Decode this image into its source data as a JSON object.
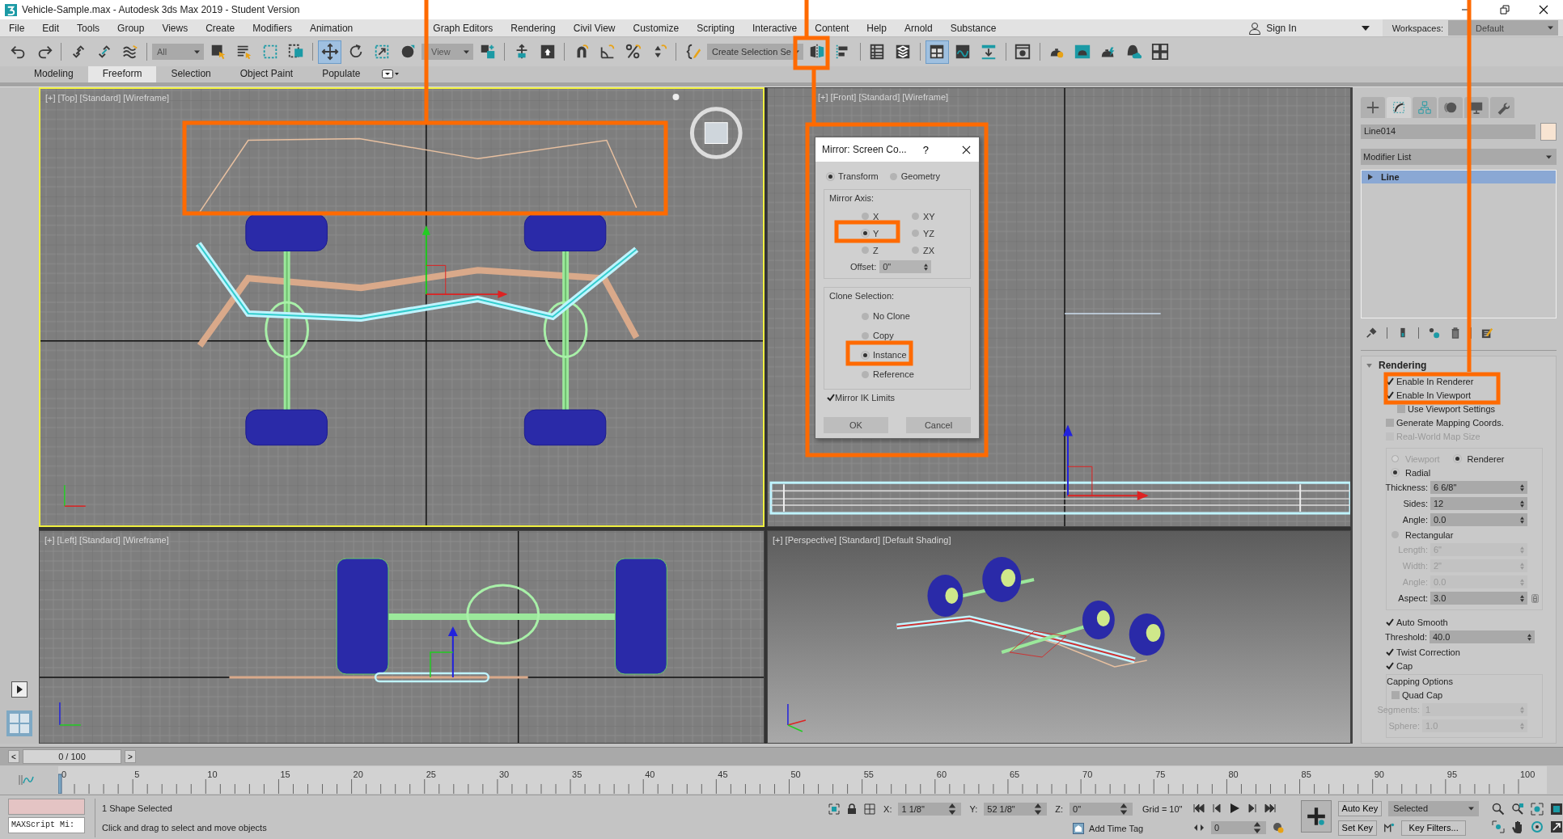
{
  "window": {
    "title": "Vehicle-Sample.max - Autodesk 3ds Max 2019 - Student Version"
  },
  "menu_bar": {
    "items": [
      "File",
      "Edit",
      "Tools",
      "Group",
      "Views",
      "Create",
      "Modifiers",
      "Animation",
      "Graph Editors",
      "Rendering",
      "Civil View",
      "Customize",
      "Scripting",
      "Interactive",
      "Content",
      "Help",
      "Arnold",
      "Substance"
    ],
    "sign_in": "Sign In",
    "workspaces_label": "Workspaces:",
    "workspace": "Default"
  },
  "main_toolbar": [
    {
      "kind": "icon",
      "selected": false
    },
    {
      "kind": "icon",
      "selected": false
    },
    {
      "kind": "separator"
    },
    {
      "kind": "icon",
      "selected": false
    },
    {
      "kind": "icon",
      "selected": false
    },
    {
      "kind": "icon",
      "selected": false
    },
    {
      "kind": "separator"
    },
    {
      "kind": "dropdown",
      "value": "All"
    },
    {
      "kind": "icon",
      "selected": false
    },
    {
      "kind": "icon",
      "selected": false
    },
    {
      "kind": "icon",
      "selected": false
    },
    {
      "kind": "icon",
      "selected": false
    },
    {
      "kind": "separator"
    },
    {
      "kind": "icon",
      "selected": true
    },
    {
      "kind": "icon",
      "selected": false
    },
    {
      "kind": "icon",
      "selected": false
    },
    {
      "kind": "icon",
      "selected": false
    },
    {
      "kind": "dropdown",
      "value": "View"
    },
    {
      "kind": "icon",
      "selected": false
    },
    {
      "kind": "separator"
    },
    {
      "kind": "icon",
      "selected": false
    },
    {
      "kind": "icon",
      "selected": false
    },
    {
      "kind": "separator"
    },
    {
      "kind": "icon",
      "selected": false
    },
    {
      "kind": "icon",
      "selected": false
    },
    {
      "kind": "icon",
      "selected": false
    },
    {
      "kind": "icon",
      "selected": false
    },
    {
      "kind": "separator"
    },
    {
      "kind": "icon",
      "selected": false
    },
    {
      "kind": "dropdown",
      "value": "Create Selection Se"
    },
    {
      "kind": "icon",
      "selected": false
    },
    {
      "kind": "icon",
      "selected": false
    },
    {
      "kind": "separator"
    },
    {
      "kind": "icon",
      "selected": false
    },
    {
      "kind": "icon",
      "selected": false
    },
    {
      "kind": "separator"
    },
    {
      "kind": "icon",
      "selected": true
    },
    {
      "kind": "icon",
      "selected": false
    },
    {
      "kind": "icon",
      "selected": false
    },
    {
      "kind": "separator"
    },
    {
      "kind": "icon",
      "selected": false
    },
    {
      "kind": "separator"
    },
    {
      "kind": "icon",
      "selected": false
    },
    {
      "kind": "icon",
      "selected": false
    },
    {
      "kind": "icon",
      "selected": false
    },
    {
      "kind": "icon",
      "selected": false
    },
    {
      "kind": "icon",
      "selected": false
    }
  ],
  "ribbon_tabs": [
    {
      "label": "Modeling",
      "selected": false
    },
    {
      "label": "Freeform",
      "selected": true
    },
    {
      "label": "Selection",
      "selected": false
    },
    {
      "label": "Object Paint",
      "selected": false
    },
    {
      "label": "Populate",
      "selected": false
    }
  ],
  "viewports": [
    {
      "kind": "top",
      "label": "[+] [Top] [Standard] [Wireframe]",
      "active": true
    },
    {
      "kind": "front",
      "label": "[+] [Front] [Standard] [Wireframe]",
      "active": false
    },
    {
      "kind": "left",
      "label": "[+] [Left] [Standard] [Wireframe]",
      "active": false
    },
    {
      "kind": "perspective",
      "label": "[+] [Perspective] [Standard] [Default Shading]",
      "active": false
    }
  ],
  "mirror_dialog": {
    "title": "Mirror: Screen Co...",
    "help": "?",
    "mode": [
      {
        "label": "Transform",
        "selected": true
      },
      {
        "label": "Geometry",
        "selected": false
      }
    ],
    "mirror_axis": {
      "title": "Mirror Axis:",
      "axes": [
        {
          "label": "X",
          "selected": false
        },
        {
          "label": "Y",
          "selected": true
        },
        {
          "label": "Z",
          "selected": false
        },
        {
          "label": "XY",
          "selected": false
        },
        {
          "label": "YZ",
          "selected": false
        },
        {
          "label": "ZX",
          "selected": false
        }
      ],
      "offset_label": "Offset:",
      "offset": "0\""
    },
    "clone_selection": {
      "title": "Clone Selection:",
      "options": [
        {
          "label": "No Clone",
          "selected": false
        },
        {
          "label": "Copy",
          "selected": false
        },
        {
          "label": "Instance",
          "selected": true
        },
        {
          "label": "Reference",
          "selected": false
        }
      ]
    },
    "mirror_ik_limits": {
      "label": "Mirror IK Limits",
      "checked": true
    },
    "buttons": [
      "OK",
      "Cancel"
    ]
  },
  "command_panel": {
    "tabs": [
      {
        "selected": false
      },
      {
        "selected": true
      },
      {
        "selected": false
      },
      {
        "selected": false
      },
      {
        "selected": false
      },
      {
        "selected": false
      }
    ],
    "object_name": "Line014",
    "modifier_list": "Modifier List",
    "stack": [
      {
        "label": "Line",
        "selected": true
      }
    ],
    "rendering": {
      "title": "Rendering",
      "expanded": true,
      "checks": [
        {
          "label": "Enable In Renderer",
          "checked": true,
          "disabled": false
        },
        {
          "label": "Enable In Viewport",
          "checked": true,
          "disabled": false,
          "children": [
            {
              "label": "Use Viewport Settings",
              "checked": false,
              "disabled": false
            }
          ]
        },
        {
          "label": "Generate Mapping Coords.",
          "checked": false,
          "disabled": false
        },
        {
          "label": "Real-World Map Size",
          "checked": false,
          "disabled": true
        }
      ],
      "mode": [
        {
          "label": "Viewport",
          "selected": false,
          "disabled": true
        },
        {
          "label": "Renderer",
          "selected": true,
          "disabled": false
        }
      ],
      "shapes": [
        {
          "label": "Radial",
          "selected": true,
          "params": [
            {
              "label": "Thickness:",
              "value": "6 6/8\"",
              "disabled": false
            },
            {
              "label": "Sides:",
              "value": "12",
              "disabled": false
            },
            {
              "label": "Angle:",
              "value": "0.0",
              "disabled": false
            }
          ]
        },
        {
          "label": "Rectangular",
          "selected": false,
          "params": [
            {
              "label": "Length:",
              "value": "6\"",
              "disabled": true
            },
            {
              "label": "Width:",
              "value": "2\"",
              "disabled": true
            },
            {
              "label": "Angle:",
              "value": "0.0",
              "disabled": true
            },
            {
              "label": "Aspect:",
              "value": "3.0",
              "disabled": false
            }
          ]
        }
      ],
      "auto_smooth": {
        "label": "Auto Smooth",
        "checked": true,
        "threshold": {
          "label": "Threshold:",
          "value": "40.0",
          "disabled": false
        }
      },
      "twist_correction": {
        "label": "Twist Correction",
        "checked": true
      },
      "cap": {
        "label": "Cap",
        "checked": true
      },
      "capping": {
        "title": "Capping Options",
        "quad_cap": {
          "label": "Quad Cap",
          "checked": false
        },
        "params": [
          {
            "label": "Segments:",
            "value": "1",
            "disabled": true
          },
          {
            "label": "Sphere:",
            "value": "1.0",
            "disabled": true
          }
        ]
      }
    }
  },
  "time_slider": {
    "prev": "<",
    "position": "0 / 100",
    "next": ">"
  },
  "timeline": {
    "frame_labels": [
      "0",
      "5",
      "10",
      "15",
      "20",
      "25",
      "30",
      "35",
      "40",
      "45",
      "50",
      "55",
      "60",
      "65",
      "70",
      "75",
      "80",
      "85",
      "90",
      "95",
      "100"
    ]
  },
  "status_bar": {
    "maxscript": "MAXScript Mi:",
    "selection": "1 Shape Selected",
    "prompt": "Click and drag to select and move objects",
    "coords": [
      {
        "label": "X:",
        "value": "1 1/8\""
      },
      {
        "label": "Y:",
        "value": "52 1/8\""
      },
      {
        "label": "Z:",
        "value": "0\""
      }
    ],
    "grid": "Grid = 10\"",
    "add_time_tag": "Add Time Tag",
    "frame": "0",
    "auto_key": "Auto Key",
    "key_mode": "Selected",
    "set_key": "Set Key",
    "key_filters": "Key Filters..."
  }
}
